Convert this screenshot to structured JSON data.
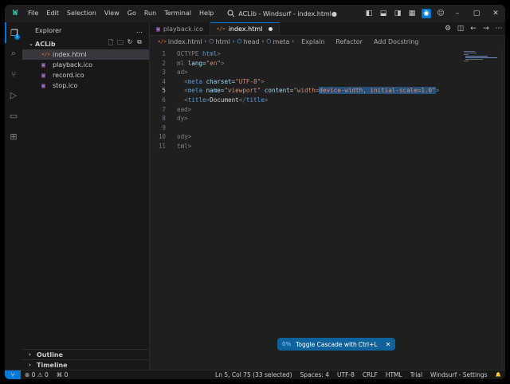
{
  "titlebar": {
    "logo": "W",
    "menu": [
      "File",
      "Edit",
      "Selection",
      "View",
      "Go",
      "Run",
      "Terminal",
      "Help"
    ],
    "title": "ACLib - Windsurf - index.html●",
    "window_controls": [
      "–",
      "▢",
      "✕"
    ]
  },
  "activity": {
    "explorer_badge": "1"
  },
  "sidebar": {
    "header": "Explorer",
    "more": "…",
    "folder": "ACLib",
    "files": [
      {
        "name": "index.html",
        "icon": "</>",
        "type": "html",
        "selected": true
      },
      {
        "name": "playback.ico",
        "icon": "▣",
        "type": "image",
        "selected": false
      },
      {
        "name": "record.ico",
        "icon": "▣",
        "type": "image",
        "selected": false
      },
      {
        "name": "stop.ico",
        "icon": "▣",
        "type": "image",
        "selected": false
      }
    ],
    "outline": "Outline",
    "timeline": "Timeline"
  },
  "tabs": [
    {
      "label": "playback.ico",
      "icon": "▣",
      "active": false,
      "dirty": false
    },
    {
      "label": "index.html",
      "icon": "</>",
      "active": true,
      "dirty": true
    }
  ],
  "breadcrumb": {
    "file": "index.html",
    "items": [
      "html",
      "head",
      "meta"
    ],
    "lenses": [
      "Explain",
      "Refactor",
      "Add Docstring"
    ]
  },
  "code": {
    "current_line": 5,
    "lines": [
      {
        "n": "1",
        "parts": [
          [
            "t-gray",
            "OCTYPE "
          ],
          [
            "t-tag",
            "html"
          ],
          [
            "t-gray",
            ">"
          ]
        ]
      },
      {
        "n": "2",
        "parts": [
          [
            "t-gray",
            "ml "
          ],
          [
            "t-attr",
            "lang"
          ],
          [
            "txt",
            "="
          ],
          [
            "t-str",
            "\"en\""
          ],
          [
            "t-gray",
            ">"
          ]
        ]
      },
      {
        "n": "3",
        "parts": [
          [
            "t-gray",
            "ad>"
          ]
        ]
      },
      {
        "n": "4",
        "parts": [
          [
            "txt",
            "  "
          ],
          [
            "t-gray",
            "<"
          ],
          [
            "t-tag",
            "meta "
          ],
          [
            "t-attr",
            "charset"
          ],
          [
            "txt",
            "="
          ],
          [
            "t-str",
            "\"UTF-8\""
          ],
          [
            "t-gray",
            ">"
          ]
        ]
      },
      {
        "n": "5",
        "parts": [
          [
            "txt",
            "  "
          ],
          [
            "t-gray",
            "<"
          ],
          [
            "t-tag",
            "meta "
          ],
          [
            "t-attr",
            "name"
          ],
          [
            "txt",
            "="
          ],
          [
            "t-str",
            "\"viewport\" "
          ],
          [
            "t-attr",
            "content"
          ],
          [
            "txt",
            "="
          ],
          [
            "t-str",
            "\"width="
          ],
          [
            "t-sel",
            "device-width, initial-scale=1.0\""
          ],
          [
            "t-gray",
            ">"
          ]
        ]
      },
      {
        "n": "6",
        "parts": [
          [
            "txt",
            "  "
          ],
          [
            "t-gray",
            "<"
          ],
          [
            "t-tag",
            "title"
          ],
          [
            "t-gray",
            ">"
          ],
          [
            "txt",
            "Document"
          ],
          [
            "t-gray",
            "</"
          ],
          [
            "t-tag",
            "title"
          ],
          [
            "t-gray",
            ">"
          ]
        ]
      },
      {
        "n": "7",
        "parts": [
          [
            "t-gray",
            "ead>"
          ]
        ]
      },
      {
        "n": "8",
        "parts": [
          [
            "t-gray",
            "dy>"
          ]
        ]
      },
      {
        "n": "9",
        "parts": []
      },
      {
        "n": "10",
        "parts": [
          [
            "t-gray",
            "ody>"
          ]
        ]
      },
      {
        "n": "11",
        "parts": [
          [
            "t-gray",
            "tml>"
          ]
        ]
      }
    ]
  },
  "toast": {
    "percent": "0%",
    "label": "Toggle Cascade with",
    "shortcut": "Ctrl+L",
    "close": "✕"
  },
  "statusbar": {
    "remote_icon": "⑂",
    "errors": "0",
    "warnings": "0",
    "ports": "0",
    "position": "Ln 5, Col 75 (33 selected)",
    "spaces": "Spaces: 4",
    "encoding": "UTF-8",
    "eol": "CRLF",
    "language": "HTML",
    "plan": "Trial",
    "settings": "Windsurf - Settings",
    "bell": "🔔"
  },
  "colors": {
    "accent": "#0078d4",
    "selection": "#264f78"
  }
}
